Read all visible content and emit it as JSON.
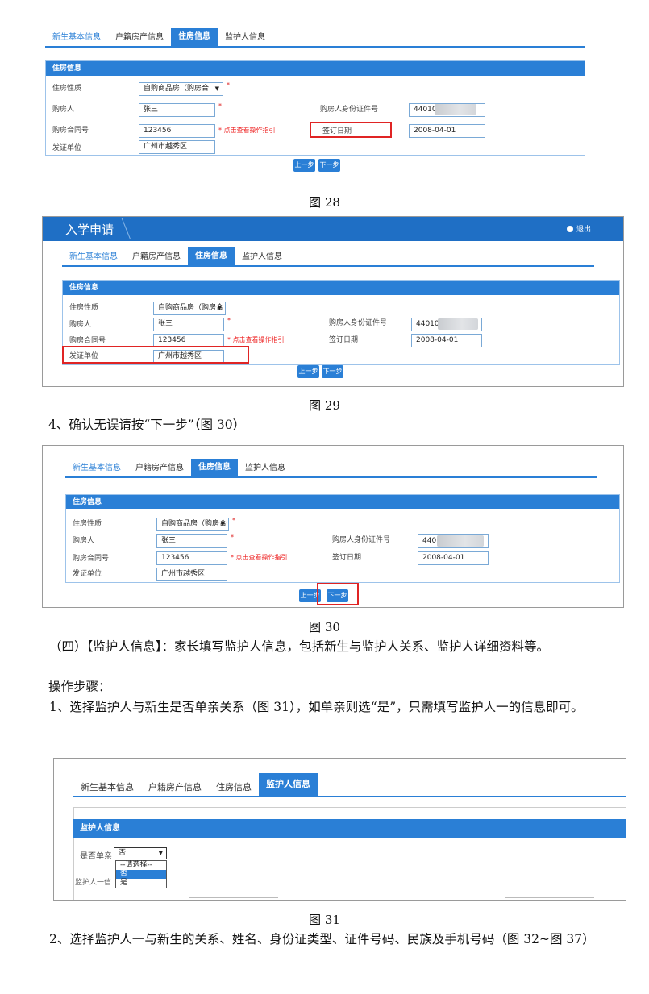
{
  "form": {
    "tabs": [
      "新生基本信息",
      "户籍房产信息",
      "住房信息",
      "监护人信息"
    ],
    "panel_title": "住房信息",
    "labels": {
      "housing_type": "住房性质",
      "buyer": "购房人",
      "buyer_id": "购房人身份证件号",
      "contract_no": "购房合同号",
      "sign_date": "签订日期",
      "issuer": "发证单位"
    },
    "values": {
      "housing_type": "自购商品房（购房合",
      "buyer": "张三",
      "contract_no": "123456",
      "sign_date": "2008-04-01",
      "issuer": "广州市越秀区"
    },
    "id_prefix": {
      "fig28": "440103",
      "fig29": "440103",
      "fig30": "4401"
    },
    "hint": "点击查看操作指引",
    "prev_button": "上一步",
    "next_button": "下一步"
  },
  "app_header": {
    "title": "入学申请",
    "logout": "退出"
  },
  "guardian_form": {
    "tabs": [
      "新生基本信息",
      "户籍房产信息",
      "住房信息",
      "监护人信息"
    ],
    "panel_title": "监护人信息",
    "single_parent_label": "是否单亲",
    "selected": "否",
    "options": [
      "--请选择--",
      "否",
      "是"
    ],
    "guardian_one_label": "监护人一信"
  },
  "doc": {
    "fig28": "图 28",
    "fig29": "图 29",
    "step4": "4、确认无误请按“下一步”（图 30）",
    "fig30": "图 30",
    "section4": "（四）【监护人信息】：家长填写监护人信息，包括新生与监护人关系、监护人详细资料等。",
    "steps_title": "操作步骤：",
    "step1": "1、选择监护人与新生是否单亲关系（图 31），如单亲则选“是”，只需填写监护人一的信息即可。",
    "fig31": "图 31",
    "step2": "2、选择监护人一与新生的关系、姓名、身份证类型、证件号码、民族及手机号码（图 32~图 37）"
  },
  "colors": {
    "accent": "#2a7fd6",
    "highlight": "#e02424"
  }
}
